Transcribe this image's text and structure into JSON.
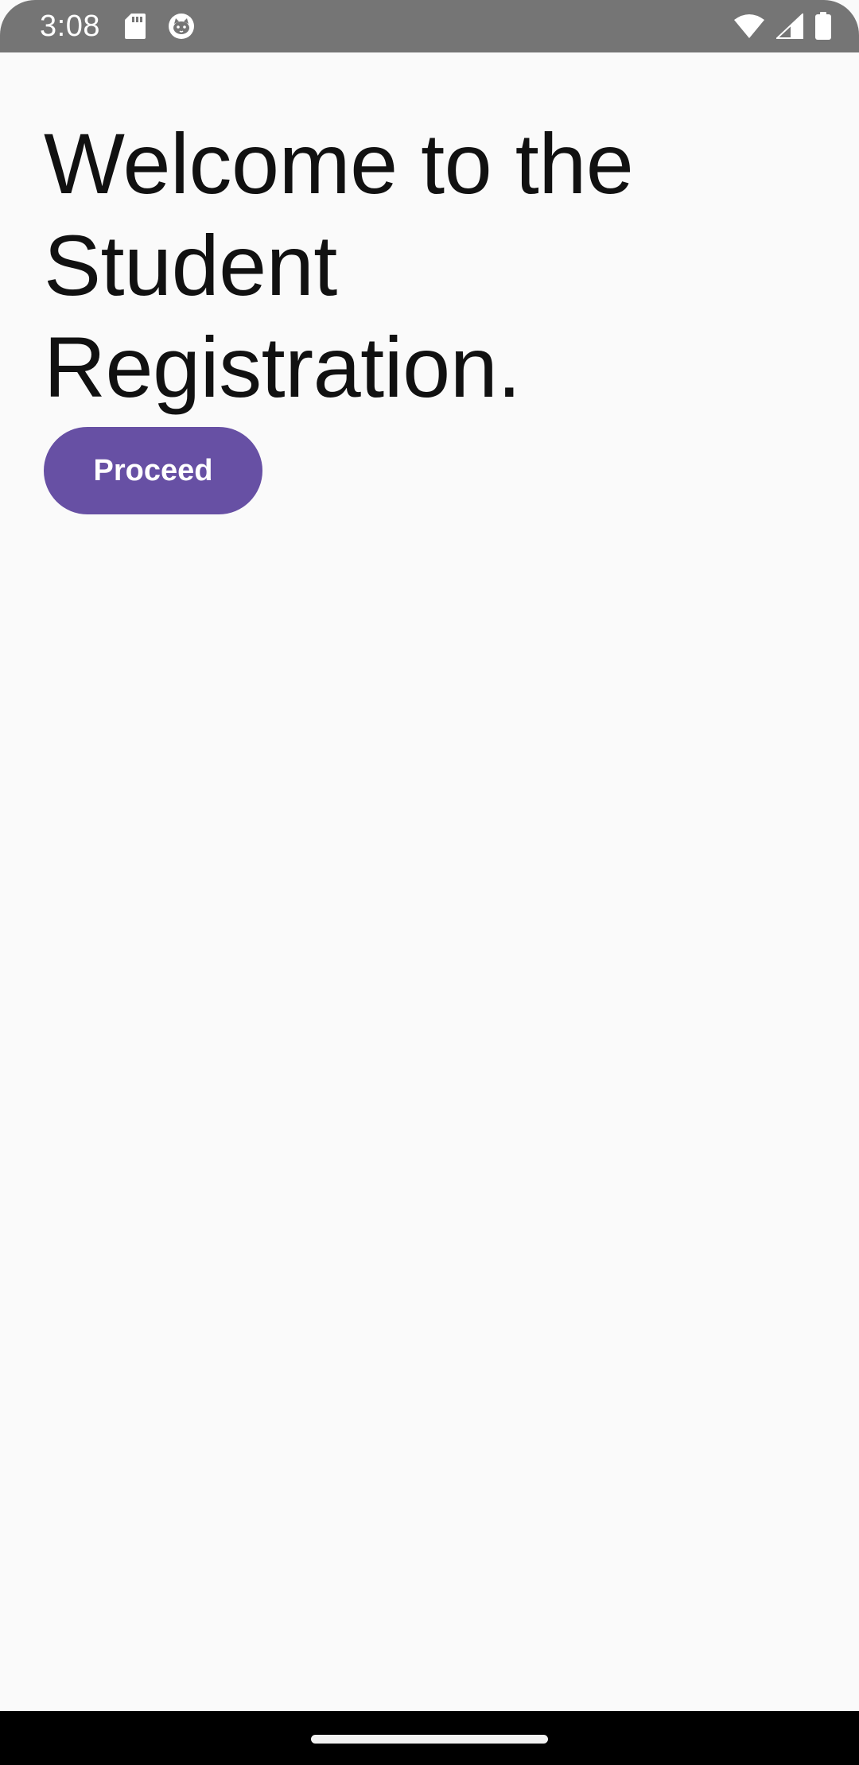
{
  "status_bar": {
    "time": "3:08",
    "icons_left": [
      "sd-card-icon",
      "cat-face-icon"
    ],
    "icons_right": [
      "wifi-icon",
      "cellular-signal-icon",
      "battery-icon"
    ],
    "background": "#757575"
  },
  "main": {
    "headline": "Welcome to the Student Registration.",
    "proceed_label": "Proceed",
    "accent_color": "#6750a4",
    "background": "#fafafa"
  },
  "nav_bar": {
    "background": "#000000"
  }
}
